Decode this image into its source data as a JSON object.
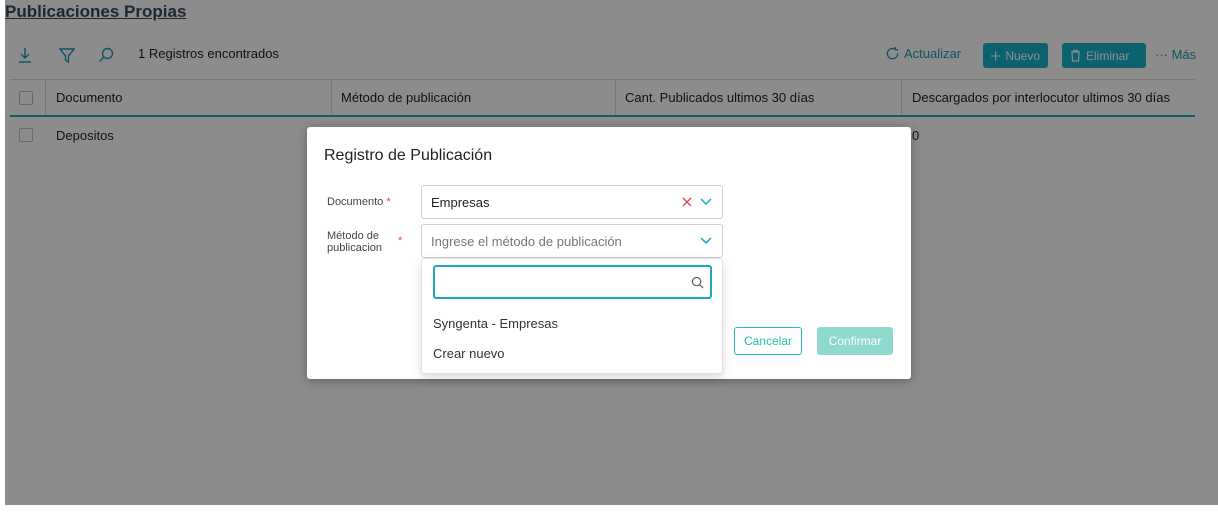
{
  "page": {
    "title": "Publicaciones Propias"
  },
  "toolbar": {
    "records_count": "1",
    "records_label": "Registros encontrados",
    "refresh_label": "Actualizar",
    "new_label": "Nuevo",
    "delete_label": "Eliminar",
    "more_label": "··· Más",
    "icons": [
      "download-icon",
      "filter-icon",
      "search-icon"
    ],
    "accent_color": "#17b3c9"
  },
  "table": {
    "columns": [
      "Documento",
      "Método de publicación",
      "Cant. Publicados ultimos 30 días",
      "Descargados por interlocutor ultimos 30 días"
    ],
    "rows": [
      {
        "documento": "Depositos",
        "descargados": "0"
      }
    ]
  },
  "modal": {
    "title": "Registro de Publicación",
    "documento_label": "Documento",
    "documento_required": "*",
    "documento_value": "Empresas",
    "metodo_label_1": "Método de",
    "metodo_label_2": "publicacion",
    "metodo_required": "*",
    "metodo_placeholder": "Ingrese el método de publicación",
    "cancel_label": "Cancelar",
    "confirm_label": "Confirmar"
  },
  "dropdown": {
    "search_value": "",
    "options": [
      "Syngenta - Empresas",
      "Crear nuevo"
    ]
  }
}
